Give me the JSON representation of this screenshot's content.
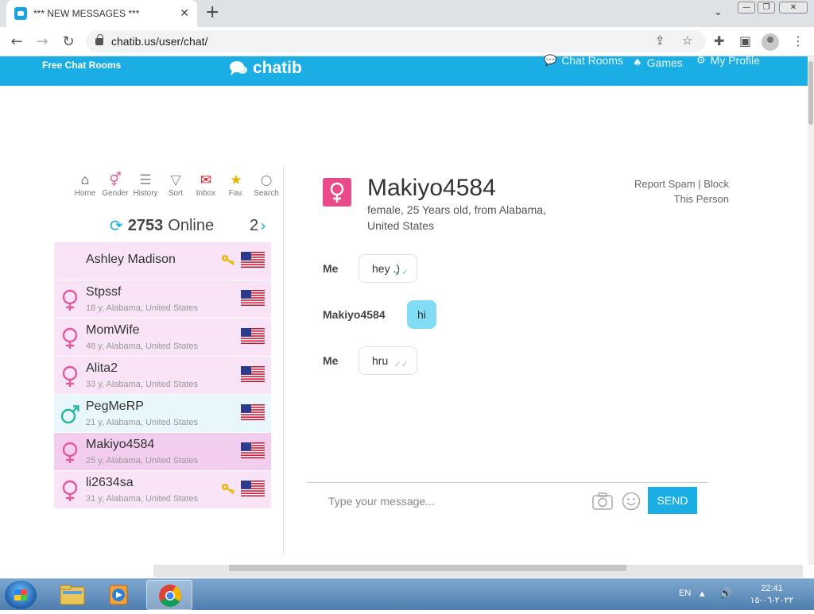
{
  "browser": {
    "tab_title": "*** NEW MESSAGES ***",
    "tab_close": "✕",
    "new_tab": "+",
    "url": "chatib.us/user/chat/",
    "window_controls": {
      "minimize": "—",
      "restore": "❐",
      "close": "✕"
    }
  },
  "site": {
    "free_chat_rooms": "Free Chat Rooms",
    "logo": "chatib",
    "nav": [
      {
        "icon": "chat-bubbles-icon",
        "label": "Chat Rooms"
      },
      {
        "icon": "cards-icon",
        "label": "Games"
      },
      {
        "icon": "gear-icon",
        "label": "My Profile"
      }
    ]
  },
  "toolbar": [
    {
      "icon": "home-icon",
      "label": "Home"
    },
    {
      "icon": "gender-icon",
      "label": "Gender"
    },
    {
      "icon": "history-icon",
      "label": "History"
    },
    {
      "icon": "filter-icon",
      "label": "Sort"
    },
    {
      "icon": "envelope-icon",
      "label": "Inbox"
    },
    {
      "icon": "star-icon",
      "label": "Fav."
    },
    {
      "icon": "search-icon",
      "label": "Search"
    }
  ],
  "online": {
    "count": "2753",
    "label": "Online",
    "page": "2"
  },
  "users": [
    {
      "name": "Ashley Madison",
      "info": "",
      "gender": "none",
      "key": true
    },
    {
      "name": "Stpssf",
      "info": "18 y, Alabama, United States",
      "gender": "female",
      "key": false
    },
    {
      "name": "MomWife",
      "info": "48 y, Alabama, United States",
      "gender": "female",
      "key": false
    },
    {
      "name": "Alita2",
      "info": "33 y, Alabama, United States",
      "gender": "female",
      "key": false
    },
    {
      "name": "PegMeRP",
      "info": "21 y, Alabama, United States",
      "gender": "male",
      "key": false
    },
    {
      "name": "Makiyo4584",
      "info": "25 y, Alabama, United States",
      "gender": "female",
      "key": false,
      "active": true
    },
    {
      "name": "li2634sa",
      "info": "31 y, Alabama, United States",
      "gender": "female",
      "key": true
    }
  ],
  "profile": {
    "name": "Makiyo4584",
    "details": "female, 25 Years old, from Alabama, United States",
    "report_spam": "Report Spam",
    "separator": "|",
    "block": "Block",
    "block_line2": "This Person"
  },
  "messages": [
    {
      "from": "Me",
      "text": "hey .)",
      "mine": true,
      "read": true
    },
    {
      "from": "Makiyo4584",
      "text": "hi",
      "mine": false
    },
    {
      "from": "Me",
      "text": "hru",
      "mine": true,
      "read": false
    }
  ],
  "composer": {
    "placeholder": "Type your message...",
    "send": "SEND"
  },
  "taskbar": {
    "lang": "EN",
    "time": "22:41",
    "date": "٢٠٢٢-٠٦-١٥"
  }
}
